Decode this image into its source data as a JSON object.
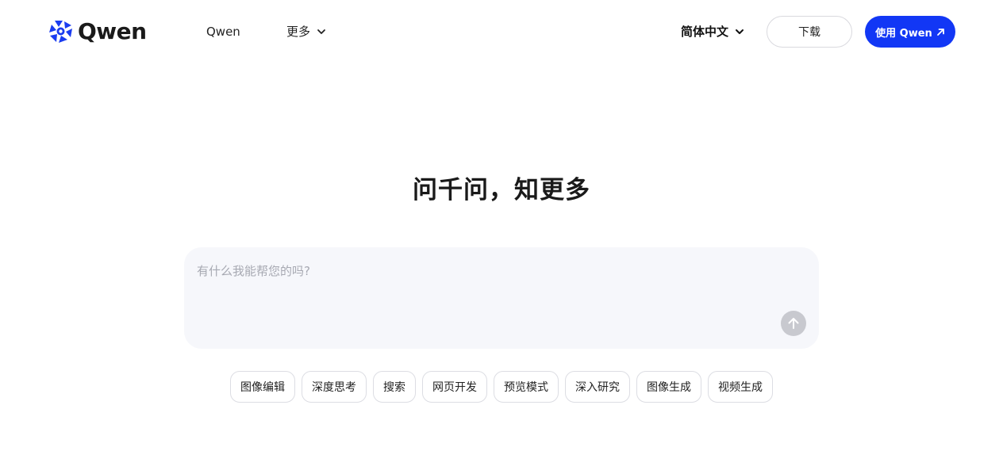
{
  "header": {
    "logo_text": "Qwen",
    "logo_icon": "qwen-star-logo",
    "nav": [
      {
        "label": "Qwen"
      },
      {
        "label": "更多",
        "icon": "chevron-down-icon"
      }
    ],
    "language": {
      "label": "简体中文",
      "icon": "chevron-down-icon"
    },
    "download_label": "下载",
    "use_label": "使用 Qwen",
    "use_icon": "arrow-up-right-icon"
  },
  "hero": {
    "title": "问千问，知更多"
  },
  "prompt": {
    "placeholder": "有什么我能帮您的吗?",
    "value": "",
    "send_icon": "arrow-up-icon"
  },
  "chips": [
    {
      "label": "图像编辑"
    },
    {
      "label": "深度思考"
    },
    {
      "label": "搜索"
    },
    {
      "label": "网页开发"
    },
    {
      "label": "预览模式"
    },
    {
      "label": "深入研究"
    },
    {
      "label": "图像生成"
    },
    {
      "label": "视频生成"
    }
  ],
  "colors": {
    "accent": "#1237f5",
    "logo": "#1a3cf0",
    "prompt_bg": "#f6f7fb",
    "send_disabled": "#c8c9cf"
  }
}
